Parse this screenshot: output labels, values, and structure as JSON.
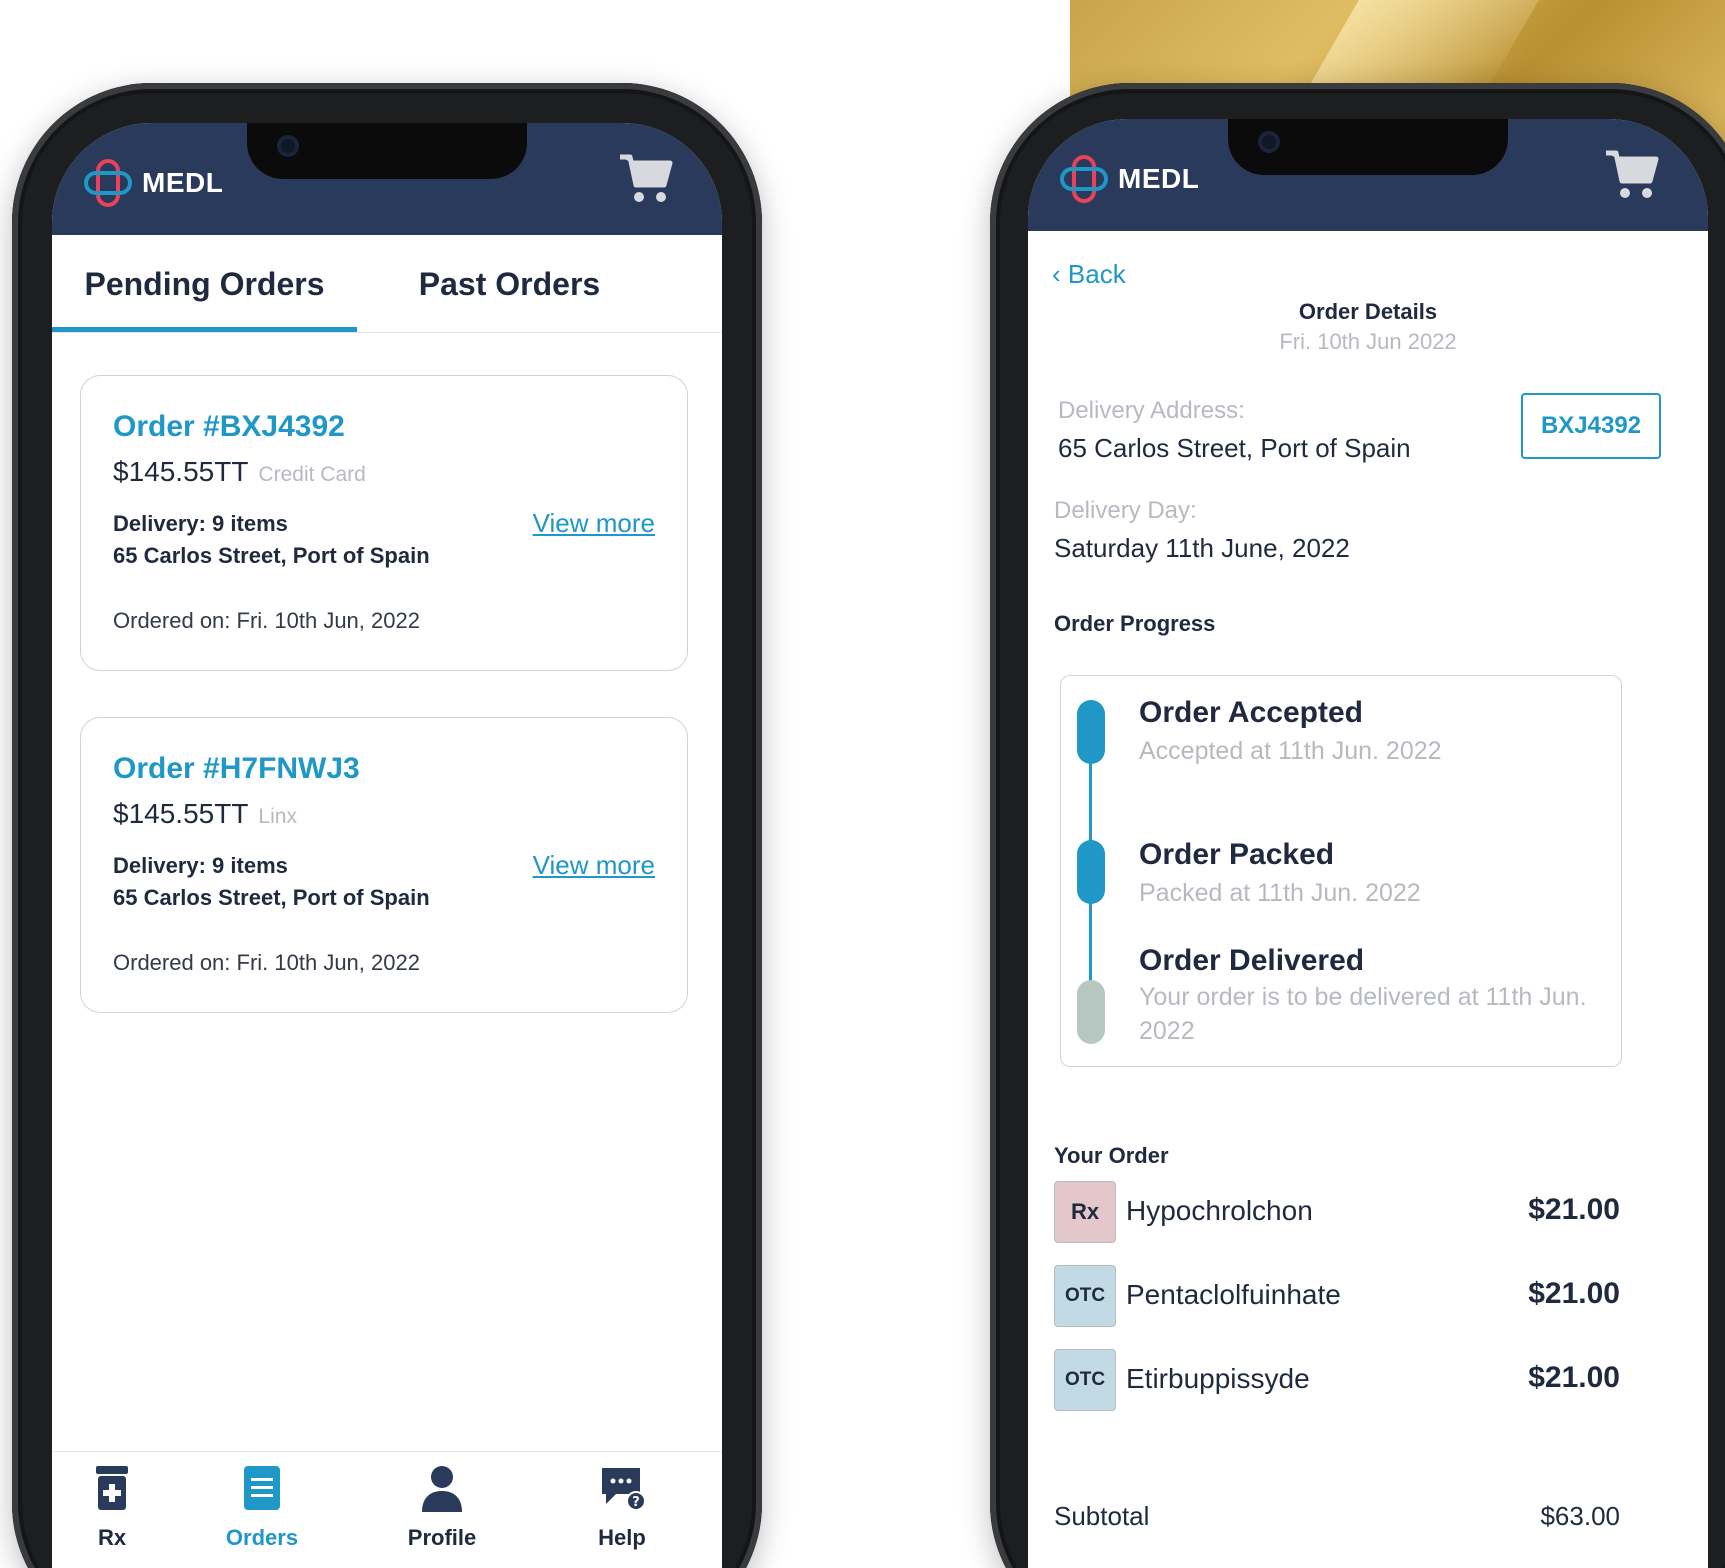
{
  "brand": {
    "name": "MEDL",
    "colors": {
      "navy": "#2a3a5a",
      "accent": "#1f97c7",
      "rx_badge": "#e3c7cb",
      "otc_badge": "#c2dae4",
      "logo_red": "#e8435a"
    }
  },
  "orders_screen": {
    "tabs": [
      {
        "label": "Pending Orders",
        "active": true
      },
      {
        "label": "Past Orders",
        "active": false
      }
    ],
    "orders": [
      {
        "number": "Order #BXJ4392",
        "amount": "$145.55TT",
        "payment": "Credit Card",
        "delivery": "Delivery: 9 items",
        "address": "65 Carlos Street, Port of Spain",
        "ordered_on": "Ordered on: Fri. 10th Jun, 2022",
        "link": "View more"
      },
      {
        "number": "Order #H7FNWJ3",
        "amount": "$145.55TT",
        "payment": "Linx",
        "delivery": "Delivery: 9 items",
        "address": "65 Carlos Street, Port of Spain",
        "ordered_on": "Ordered on: Fri. 10th Jun, 2022",
        "link": "View more"
      }
    ],
    "nav": [
      {
        "label": "Rx",
        "icon": "pill-bottle-icon"
      },
      {
        "label": "Orders",
        "icon": "orders-list-icon",
        "active": true
      },
      {
        "label": "Profile",
        "icon": "person-icon"
      },
      {
        "label": "Help",
        "icon": "chat-help-icon"
      }
    ]
  },
  "details_screen": {
    "back": "Back",
    "title": "Order Details",
    "date": "Fri. 10th Jun 2022",
    "delivery_address_label": "Delivery Address:",
    "delivery_address": "65 Carlos Street, Port of Spain",
    "order_code": "BXJ4392",
    "delivery_day_label": "Delivery Day:",
    "delivery_day": "Saturday 11th June, 2022",
    "progress_heading": "Order Progress",
    "steps": [
      {
        "title": "Order Accepted",
        "subtitle": "Accepted at 11th Jun.  2022",
        "done": true
      },
      {
        "title": "Order Packed",
        "subtitle": "Packed at 11th Jun. 2022",
        "done": true
      },
      {
        "title": "Order Delivered",
        "subtitle": "Your order is to be delivered at 11th Jun. 2022",
        "done": false
      }
    ],
    "your_order_heading": "Your Order",
    "items": [
      {
        "badge": "Rx",
        "name": "Hypochrolchon",
        "price": "$21.00"
      },
      {
        "badge": "OTC",
        "name": "Pentaclolfuinhate",
        "price": "$21.00"
      },
      {
        "badge": "OTC",
        "name": "Etirbuppissyde",
        "price": "$21.00"
      }
    ],
    "subtotal_label": "Subtotal",
    "subtotal_value": "$63.00"
  }
}
